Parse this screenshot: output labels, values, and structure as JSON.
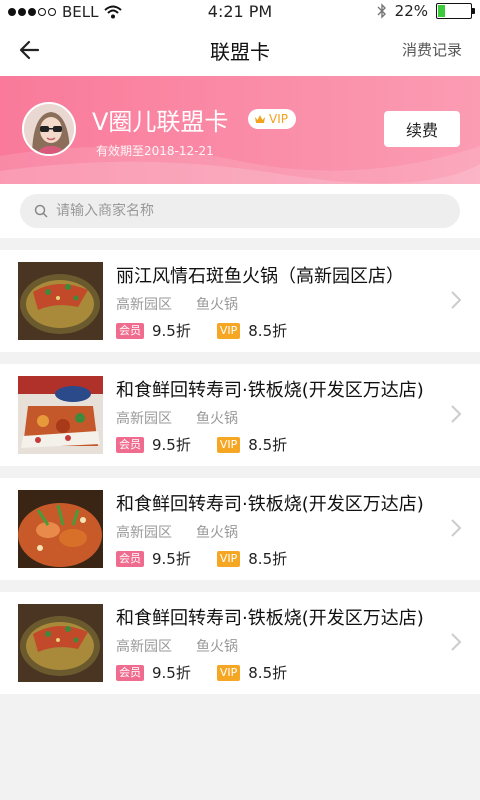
{
  "status_bar": {
    "carrier": "BELL",
    "time": "4:21 PM",
    "battery": "22%",
    "battery_level": 0.22
  },
  "nav": {
    "title": "联盟卡",
    "records_label": "消费记录"
  },
  "card": {
    "name": "V圈儿联盟卡",
    "badge": "VIP",
    "expire": "有效期至2018-12-21",
    "renew_label": "续费"
  },
  "search": {
    "placeholder": "请输入商家名称"
  },
  "stores": [
    {
      "name": "丽江风情石斑鱼火锅（高新园区店）",
      "area": "高新园区",
      "category": "鱼火锅",
      "member_tag": "会员",
      "member_price": "9.5折",
      "vip_tag": "VIP",
      "vip_price": "8.5折"
    },
    {
      "name": "和食鲜回转寿司·铁板烧(开发区万达店)",
      "area": "高新园区",
      "category": "鱼火锅",
      "member_tag": "会员",
      "member_price": "9.5折",
      "vip_tag": "VIP",
      "vip_price": "8.5折"
    },
    {
      "name": "和食鲜回转寿司·铁板烧(开发区万达店)",
      "area": "高新园区",
      "category": "鱼火锅",
      "member_tag": "会员",
      "member_price": "9.5折",
      "vip_tag": "VIP",
      "vip_price": "8.5折"
    },
    {
      "name": "和食鲜回转寿司·铁板烧(开发区万达店)",
      "area": "高新园区",
      "category": "鱼火锅",
      "member_tag": "会员",
      "member_price": "9.5折",
      "vip_tag": "VIP",
      "vip_price": "8.5折"
    }
  ],
  "colors": {
    "accent_pink": "#f97a9a",
    "member_tag": "#f06c8e",
    "vip_tag": "#f5a623"
  },
  "icons": {
    "back": "arrow-left-icon",
    "search": "search-icon",
    "chevron": "chevron-right-icon",
    "crown": "crown-icon"
  }
}
